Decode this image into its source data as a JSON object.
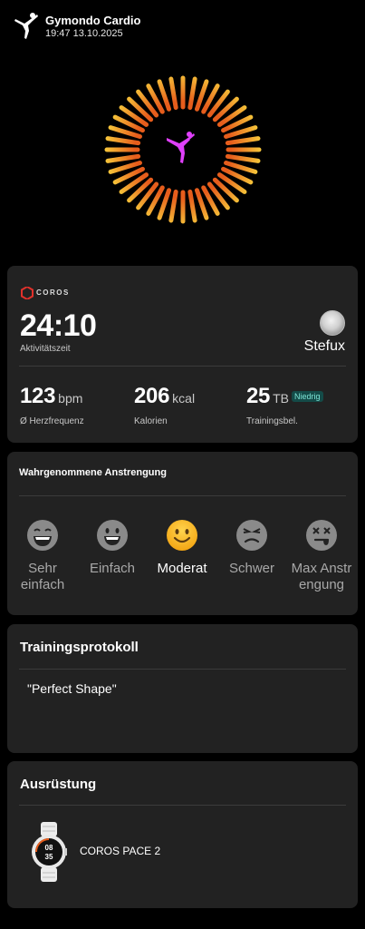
{
  "header": {
    "title": "Gymondo Cardio",
    "datetime": "19:47 13.10.2025",
    "icon": "yoga-figure-icon"
  },
  "ring": {
    "center_icon": "yoga-figure-icon",
    "accent": "#e040fb",
    "colors": [
      "#f6c63a",
      "#e65d1c"
    ]
  },
  "summary": {
    "brand": "COROS",
    "duration": "24:10",
    "duration_label": "Aktivitätszeit",
    "user_name": "Stefux",
    "stats": [
      {
        "value": "123",
        "unit": "bpm",
        "label": "Ø Herzfrequenz"
      },
      {
        "value": "206",
        "unit": "kcal",
        "label": "Kalorien"
      },
      {
        "value": "25",
        "unit": "TB",
        "label": "Trainingsbel.",
        "badge": "Niedrig"
      }
    ]
  },
  "effort": {
    "title": "Wahrgenommene Anstrengung",
    "selected": "Moderat",
    "options": [
      {
        "line1": "Sehr",
        "line2": "einfach",
        "icon": "laughing-face-icon"
      },
      {
        "line1": "Einfach",
        "line2": "",
        "icon": "grinning-face-icon"
      },
      {
        "line1": "Moderat",
        "line2": "",
        "icon": "smiling-face-icon"
      },
      {
        "line1": "Schwer",
        "line2": "",
        "icon": "straining-face-icon"
      },
      {
        "line1": "Max Anstr",
        "line2": "engung",
        "icon": "exhausted-face-icon"
      }
    ]
  },
  "log": {
    "title": "Trainingsprotokoll",
    "text": "\"Perfect Shape\""
  },
  "equipment": {
    "title": "Ausrüstung",
    "item_name": "COROS PACE 2",
    "watch_display": [
      "08",
      "35"
    ]
  }
}
